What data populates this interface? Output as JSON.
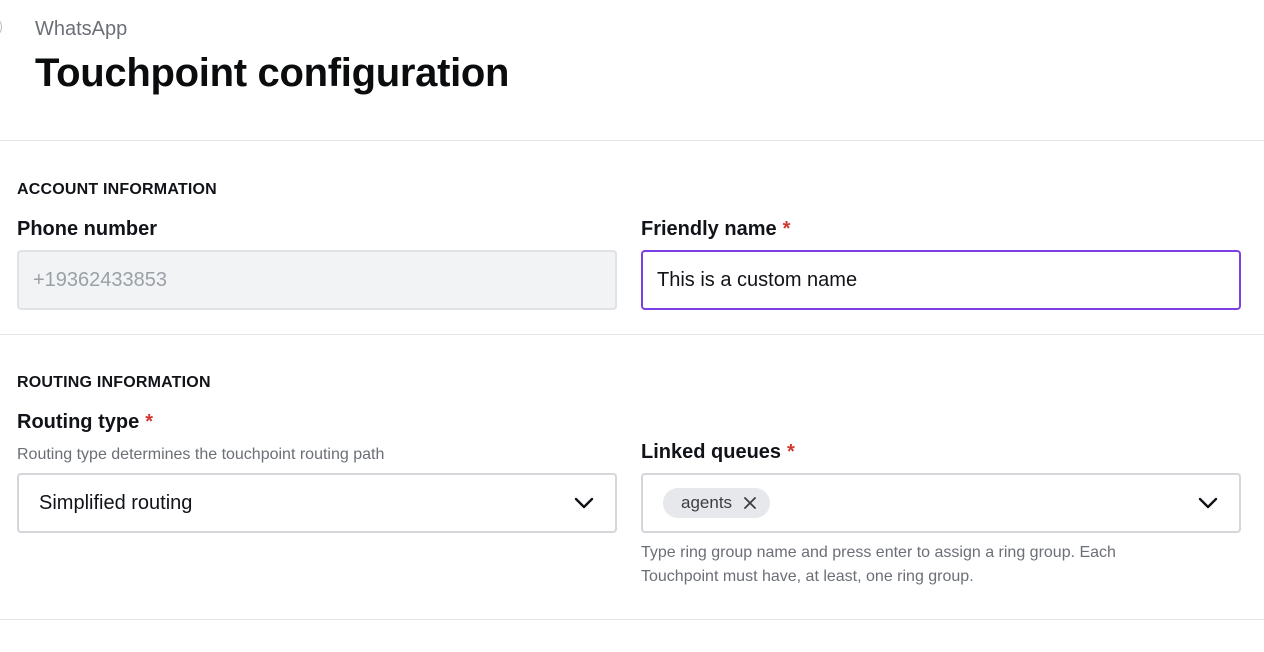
{
  "header": {
    "subtitle": "WhatsApp",
    "title": "Touchpoint configuration"
  },
  "account_section": {
    "heading": "ACCOUNT INFORMATION",
    "phone": {
      "label": "Phone number",
      "value": "+19362433853"
    },
    "friendly_name": {
      "label": "Friendly name",
      "required_mark": "*",
      "value": "This is a custom name"
    }
  },
  "routing_section": {
    "heading": "ROUTING INFORMATION",
    "routing_type": {
      "label": "Routing type",
      "required_mark": "*",
      "helper": "Routing type determines the touchpoint routing path",
      "selected": "Simplified routing"
    },
    "linked_queues": {
      "label": "Linked queues",
      "required_mark": "*",
      "chips": [
        "agents"
      ],
      "helper_line1": "Type ring group name and press enter to assign a ring group. Each",
      "helper_line2": "Touchpoint must have, at least, one ring group."
    }
  },
  "icons": {
    "chevron": "chevron-down-icon",
    "chip_remove": "close-icon"
  },
  "colors": {
    "focus": "#7b3fe4",
    "required": "#d2372f"
  }
}
